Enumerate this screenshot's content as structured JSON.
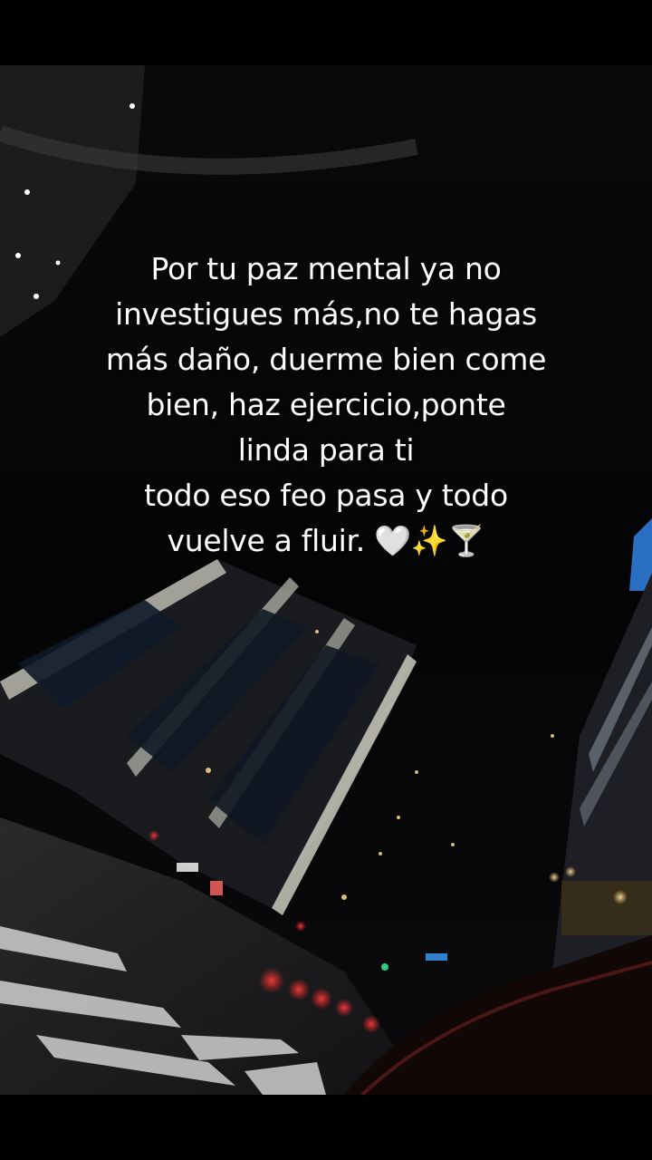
{
  "caption": {
    "lines": [
      "Por tu  paz mental ya no",
      "investigues más,no te hagas",
      "más daño, duerme bien come",
      "bien, haz ejercicio,ponte",
      "linda para ti",
      "todo eso feo pasa y todo",
      "vuelve a fluir. 🤍✨🍸"
    ]
  },
  "scene": {
    "description_colors": {
      "sky": "#040406",
      "building": "#1a1c20",
      "building_edge": "#cfcfc4",
      "light_warm": "#ffd98a",
      "light_red": "#ff2a2a",
      "light_blue": "#3aa0ff"
    }
  }
}
